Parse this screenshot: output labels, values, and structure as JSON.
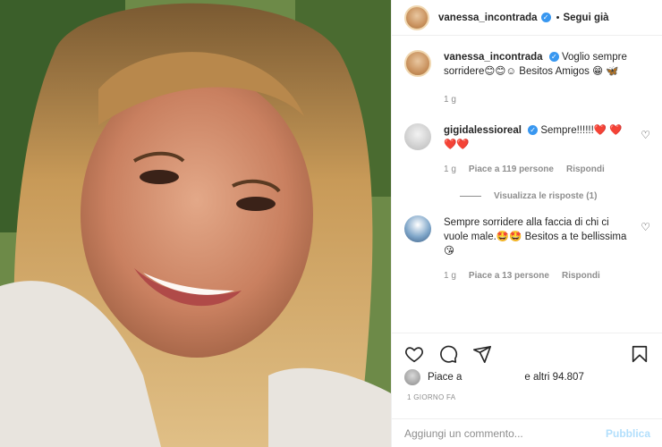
{
  "post": {
    "username": "vanessa_incontrada",
    "follow_label": "Segui già",
    "caption": "Voglio sempre sorridere😊😊☺ Besitos Amigos 😁 🦋",
    "caption_time": "1 g"
  },
  "comments": [
    {
      "username": "gigidalessioreal",
      "text": "Sempre!!!!!!❤️ ❤️❤️❤️",
      "time": "1 g",
      "likes": "Piace a 119 persone",
      "reply": "Rispondi",
      "view_replies": "Visualizza le risposte (1)"
    },
    {
      "username": "",
      "text": "Sempre sorridere alla faccia di chi ci vuole male.🤩🤩 Besitos a te bellissima 😘",
      "time": "1 g",
      "likes": "Piace a 13 persone",
      "reply": "Rispondi"
    }
  ],
  "likes_line": {
    "prefix": "Piace a",
    "suffix": "e altri 94.807"
  },
  "timestamp": "1 GIORNO FA",
  "add_comment": {
    "placeholder": "Aggiungi un commento...",
    "publish": "Pubblica"
  },
  "icons": [
    "heart-icon",
    "comment-icon",
    "share-icon",
    "bookmark-icon",
    "verified-icon"
  ],
  "colors": {
    "verified": "#3897f0",
    "publish_disabled": "#b2dffc",
    "muted": "#8e8e8e"
  }
}
